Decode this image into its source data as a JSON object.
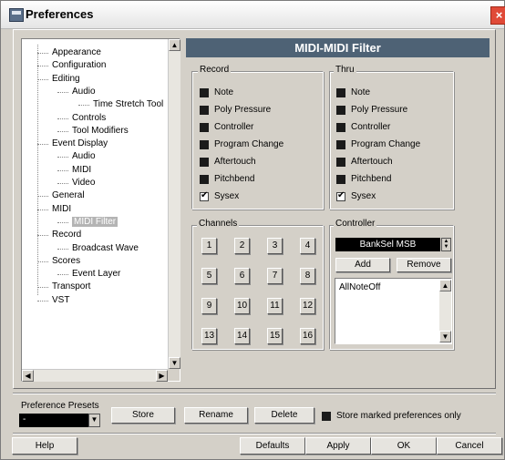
{
  "window": {
    "title": "Preferences",
    "close_glyph": "×"
  },
  "tree": {
    "items": [
      {
        "label": "Appearance",
        "level": 1
      },
      {
        "label": "Configuration",
        "level": 1
      },
      {
        "label": "Editing",
        "level": 1
      },
      {
        "label": "Audio",
        "level": 2
      },
      {
        "label": "Time Stretch Tool",
        "level": 3
      },
      {
        "label": "Controls",
        "level": 2
      },
      {
        "label": "Tool Modifiers",
        "level": 2
      },
      {
        "label": "Event Display",
        "level": 1
      },
      {
        "label": "Audio",
        "level": 2
      },
      {
        "label": "MIDI",
        "level": 2
      },
      {
        "label": "Video",
        "level": 2
      },
      {
        "label": "General",
        "level": 1
      },
      {
        "label": "MIDI",
        "level": 1
      },
      {
        "label": "MIDI Filter",
        "level": 2,
        "selected": true
      },
      {
        "label": "Record",
        "level": 1
      },
      {
        "label": "Broadcast Wave",
        "level": 2
      },
      {
        "label": "Scores",
        "level": 1
      },
      {
        "label": "Event Layer",
        "level": 2
      },
      {
        "label": "Transport",
        "level": 1
      },
      {
        "label": "VST",
        "level": 1
      }
    ]
  },
  "panel": {
    "title": "MIDI-MIDI Filter",
    "record": {
      "label": "Record",
      "items": [
        {
          "label": "Note",
          "checked": false
        },
        {
          "label": "Poly Pressure",
          "checked": false
        },
        {
          "label": "Controller",
          "checked": false
        },
        {
          "label": "Program Change",
          "checked": false
        },
        {
          "label": "Aftertouch",
          "checked": false
        },
        {
          "label": "Pitchbend",
          "checked": false
        },
        {
          "label": "Sysex",
          "checked": true
        }
      ]
    },
    "thru": {
      "label": "Thru",
      "items": [
        {
          "label": "Note",
          "checked": false
        },
        {
          "label": "Poly Pressure",
          "checked": false
        },
        {
          "label": "Controller",
          "checked": false
        },
        {
          "label": "Program Change",
          "checked": false
        },
        {
          "label": "Aftertouch",
          "checked": false
        },
        {
          "label": "Pitchbend",
          "checked": false
        },
        {
          "label": "Sysex",
          "checked": true
        }
      ]
    },
    "channels": {
      "label": "Channels",
      "buttons": [
        "1",
        "2",
        "3",
        "4",
        "5",
        "6",
        "7",
        "8",
        "9",
        "10",
        "11",
        "12",
        "13",
        "14",
        "15",
        "16"
      ]
    },
    "controller": {
      "label": "Controller",
      "selected": "BankSel MSB",
      "add_label": "Add",
      "remove_label": "Remove",
      "list": [
        "AllNoteOff"
      ]
    }
  },
  "presets": {
    "label": "Preference Presets",
    "value": "-",
    "store_label": "Store",
    "rename_label": "Rename",
    "delete_label": "Delete",
    "store_marked_label": "Store marked preferences only"
  },
  "footer": {
    "help_label": "Help",
    "defaults_label": "Defaults",
    "apply_label": "Apply",
    "ok_label": "OK",
    "cancel_label": "Cancel"
  }
}
